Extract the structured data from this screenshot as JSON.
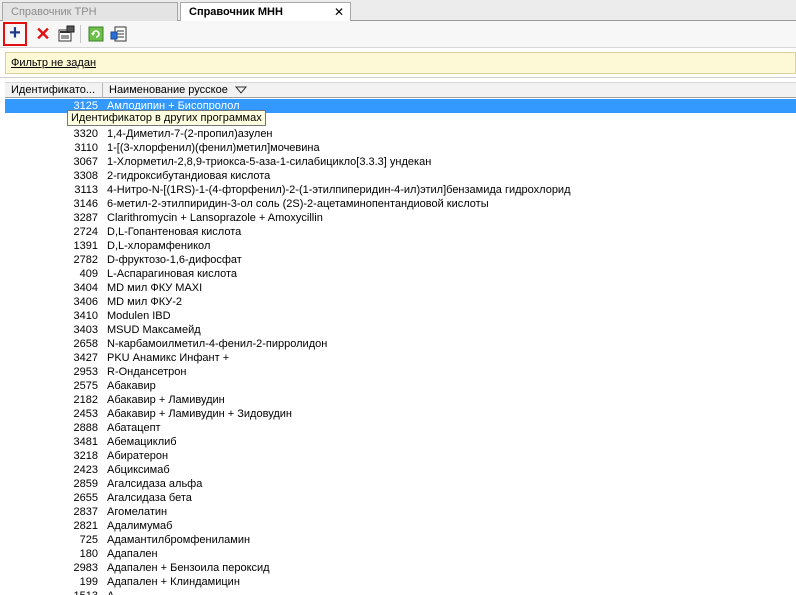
{
  "tabs": [
    {
      "label": "Справочник ТРН",
      "active": false
    },
    {
      "label": "Справочник МНН",
      "active": true,
      "close": "✕"
    }
  ],
  "toolbar": {
    "add_icon": "+",
    "delete_icon": "✕"
  },
  "filter": {
    "text": "Фильтр не задан"
  },
  "columns": {
    "id": "Идентификато...",
    "name": "Наименование русское"
  },
  "tooltip": "Идентификатор в других программах",
  "rows": [
    {
      "id": "3125",
      "name": "Амлодипин + Бисопролол",
      "selected": true
    },
    {
      "id": "",
      "name": "…ота"
    },
    {
      "id": "3320",
      "name": "1,4-Диметил-7-(2-пропил)азулен"
    },
    {
      "id": "3110",
      "name": "1-[(3-хлорфенил)(фенил)метил]мочевина"
    },
    {
      "id": "3067",
      "name": "1-Хлорметил-2,8,9-триокса-5-аза-1-силабицикло[3.3.3] ундекан"
    },
    {
      "id": "3308",
      "name": "2-гидроксибутандиовая кислота"
    },
    {
      "id": "3113",
      "name": "4-Нитро-N-[(1RS)-1-(4-фторфенил)-2-(1-этилпиперидин-4-ил)этил]бензамида гидрохлорид"
    },
    {
      "id": "3146",
      "name": "6-метил-2-этилпиридин-3-ол соль (2S)-2-ацетаминопентандиовой кислоты"
    },
    {
      "id": "3287",
      "name": "Clarithromycin + Lansoprazole + Amoxycillin"
    },
    {
      "id": "2724",
      "name": "D,L-Гопантеновая кислота"
    },
    {
      "id": "1391",
      "name": "D,L-хлорамфеникол"
    },
    {
      "id": "2782",
      "name": "D-фруктозо-1,6-дифосфат"
    },
    {
      "id": "409",
      "name": "L-Аспарагиновая кислота"
    },
    {
      "id": "3404",
      "name": "MD мил ФКУ MAXI"
    },
    {
      "id": "3406",
      "name": "MD мил ФКУ-2"
    },
    {
      "id": "3410",
      "name": "Modulen IBD"
    },
    {
      "id": "3403",
      "name": "MSUD Максамейд"
    },
    {
      "id": "2658",
      "name": "N-карбамоилметил-4-фенил-2-пирролидон"
    },
    {
      "id": "3427",
      "name": "PKU Анамикс Инфант +"
    },
    {
      "id": "2953",
      "name": "R-Ондансетрон"
    },
    {
      "id": "2575",
      "name": "Абакавир"
    },
    {
      "id": "2182",
      "name": "Абакавир + Ламивудин"
    },
    {
      "id": "2453",
      "name": "Абакавир + Ламивудин + Зидовудин"
    },
    {
      "id": "2888",
      "name": "Абатацепт"
    },
    {
      "id": "3481",
      "name": "Абемациклиб"
    },
    {
      "id": "3218",
      "name": "Абиратерон"
    },
    {
      "id": "2423",
      "name": "Абциксимаб"
    },
    {
      "id": "2859",
      "name": "Агалсидаза альфа"
    },
    {
      "id": "2655",
      "name": "Агалсидаза бета"
    },
    {
      "id": "2837",
      "name": "Агомелатин"
    },
    {
      "id": "2821",
      "name": "Адалимумаб"
    },
    {
      "id": "725",
      "name": "Адамантилбромфениламин"
    },
    {
      "id": "180",
      "name": "Адапален"
    },
    {
      "id": "2983",
      "name": "Адапален + Бензоила пероксид"
    },
    {
      "id": "199",
      "name": "Адапален + Клиндамицин"
    },
    {
      "id": "1513",
      "name": "А…"
    }
  ]
}
